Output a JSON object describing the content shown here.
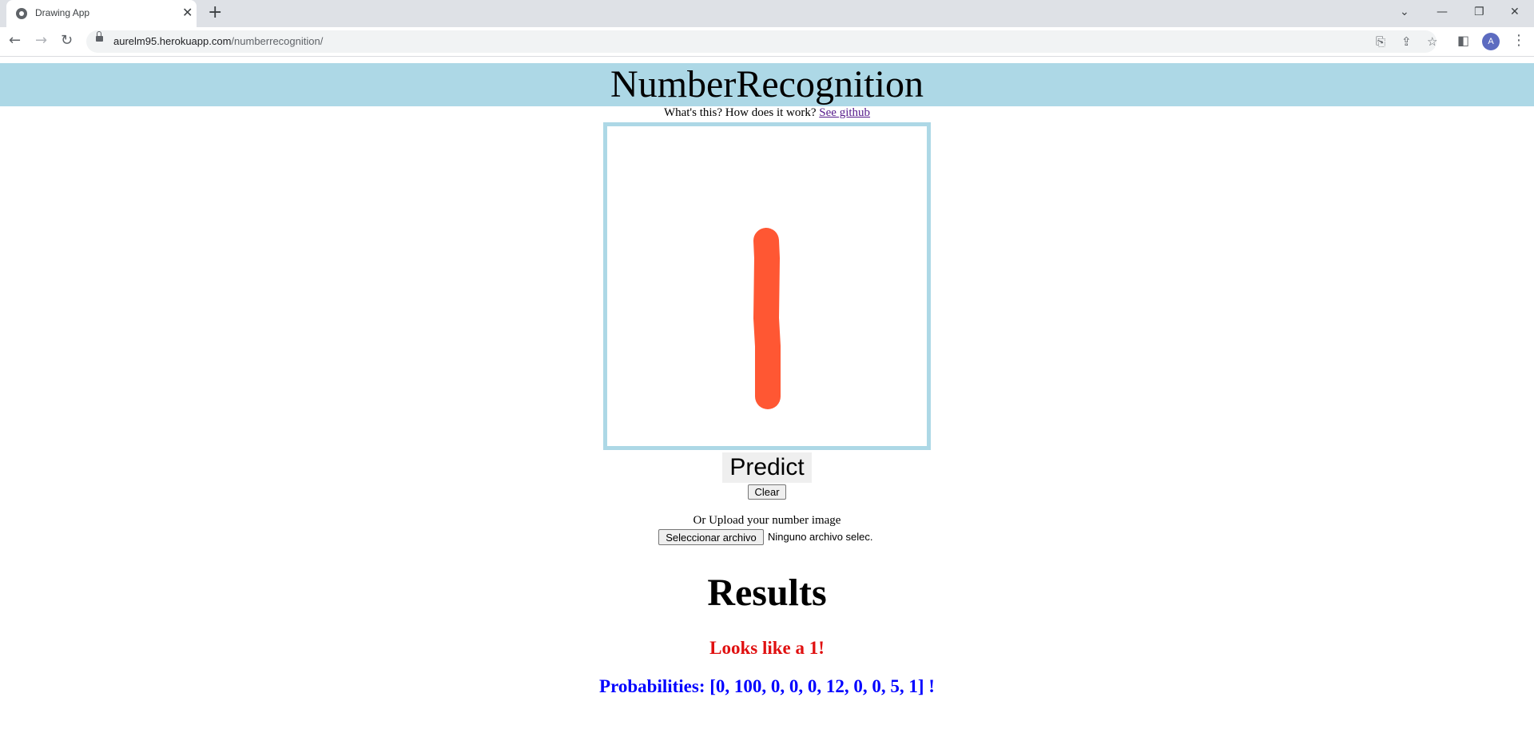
{
  "browser": {
    "tab_title": "Drawing App",
    "url_domain": "aurelm95.herokuapp.com",
    "url_path": "/numberrecognition/",
    "avatar_letter": "A"
  },
  "page": {
    "title": "NumberRecognition",
    "info_text": "What's this? How does it work? ",
    "info_link": "See github",
    "stroke_color": "#ff5733",
    "banner_color": "#add8e6",
    "predict_label": "Predict",
    "clear_label": "Clear",
    "upload_label": "Or Upload your number image",
    "file_button_label": "Seleccionar archivo",
    "file_status": "Ninguno archivo selec.",
    "results_heading": "Results",
    "prediction_text": "Looks like a 1!",
    "probabilities_text": "Probabilities: [0, 100, 0, 0, 0, 12, 0, 0, 5, 1] !"
  }
}
